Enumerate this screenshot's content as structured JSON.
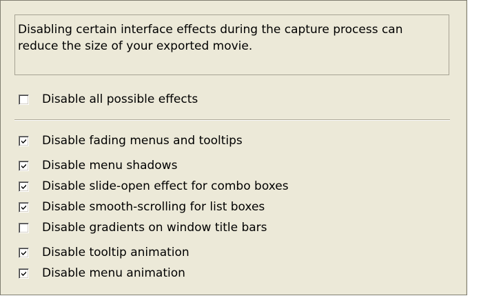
{
  "description": "Disabling certain interface effects during the capture process can reduce the size of your exported movie.",
  "disable_all": {
    "label": "Disable all possible effects",
    "checked": false
  },
  "effects": [
    {
      "label": "Disable fading menus and tooltips",
      "checked": true
    },
    {
      "label": "Disable menu shadows",
      "checked": true
    },
    {
      "label": "Disable slide-open effect for combo boxes",
      "checked": true
    },
    {
      "label": "Disable smooth-scrolling for list boxes",
      "checked": true
    },
    {
      "label": "Disable gradients on window title bars",
      "checked": false
    },
    {
      "label": "Disable tooltip animation",
      "checked": true
    },
    {
      "label": "Disable menu animation",
      "checked": true
    }
  ]
}
